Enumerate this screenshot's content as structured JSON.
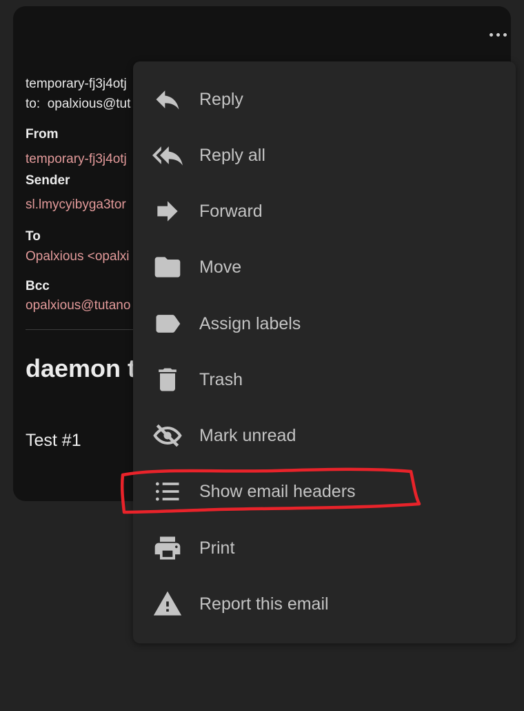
{
  "email": {
    "sender_line": "temporary-fj3j4otj",
    "to_line_prefix": "to:",
    "to_line_value": "opalxious@tut",
    "from_label": "From",
    "from_value": "temporary-fj3j4otj",
    "sender_label": "Sender",
    "sender_value": "sl.lmycyibyga3tor",
    "to_label": "To",
    "to_value": "Opalxious <opalxi",
    "bcc_label": "Bcc",
    "bcc_value": "opalxious@tutano",
    "subject": "daemon t",
    "body": "Test #1"
  },
  "more_button": {
    "icon": "more-horizontal-icon"
  },
  "menu": {
    "items": [
      {
        "label": "Reply",
        "icon": "reply-icon"
      },
      {
        "label": "Reply all",
        "icon": "reply-all-icon"
      },
      {
        "label": "Forward",
        "icon": "forward-icon"
      },
      {
        "label": "Move",
        "icon": "folder-icon"
      },
      {
        "label": "Assign labels",
        "icon": "label-icon"
      },
      {
        "label": "Trash",
        "icon": "trash-icon"
      },
      {
        "label": "Mark unread",
        "icon": "eye-off-icon"
      },
      {
        "label": "Show email headers",
        "icon": "list-icon"
      },
      {
        "label": "Print",
        "icon": "printer-icon"
      },
      {
        "label": "Report this email",
        "icon": "warning-icon"
      }
    ]
  },
  "colors": {
    "background": "#232323",
    "card": "#121212",
    "menu": "#262626",
    "address_link": "#e39a9a",
    "highlight_annotation": "#e8232a"
  }
}
